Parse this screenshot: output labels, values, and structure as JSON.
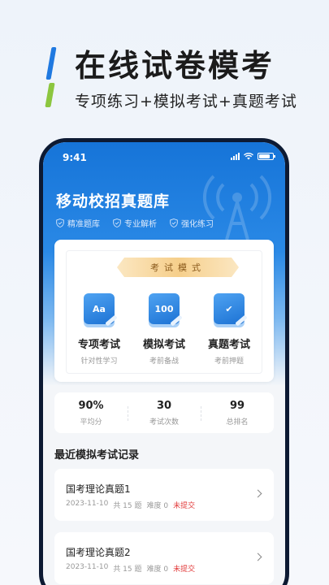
{
  "promo": {
    "title": "在线试卷模考",
    "subtitle": "专项练习+模拟考试+真题考试"
  },
  "status_bar": {
    "time": "9:41"
  },
  "header": {
    "title": "移动校招真题库",
    "features": [
      "精准题库",
      "专业解析",
      "强化练习"
    ]
  },
  "exam_mode": {
    "banner": "考试模式",
    "modes": [
      {
        "icon_text": "Aa",
        "label": "专项考试",
        "sub": "针对性学习",
        "icon": "font-book-icon"
      },
      {
        "icon_text": "100",
        "label": "模拟考试",
        "sub": "考前备战",
        "icon": "score-book-icon"
      },
      {
        "icon_text": "✔",
        "label": "真题考试",
        "sub": "考前押题",
        "icon": "check-book-icon"
      }
    ]
  },
  "stats": [
    {
      "value": "90%",
      "label": "平均分"
    },
    {
      "value": "30",
      "label": "考试次数"
    },
    {
      "value": "99",
      "label": "总排名"
    }
  ],
  "records": {
    "title": "最近模拟考试记录",
    "items": [
      {
        "name": "国考理论真题1",
        "date": "2023-11-10",
        "count": "共 15 题",
        "difficulty": "难度 0",
        "status": "未提交"
      },
      {
        "name": "国考理论真题2",
        "date": "2023-11-10",
        "count": "共 15 题",
        "difficulty": "难度 0",
        "status": "未提交"
      }
    ]
  },
  "colors": {
    "primary": "#1f79e0",
    "accent_green": "#8cc63f",
    "status_red": "#e23b3b",
    "banner_gold": "#f6cf8b"
  }
}
